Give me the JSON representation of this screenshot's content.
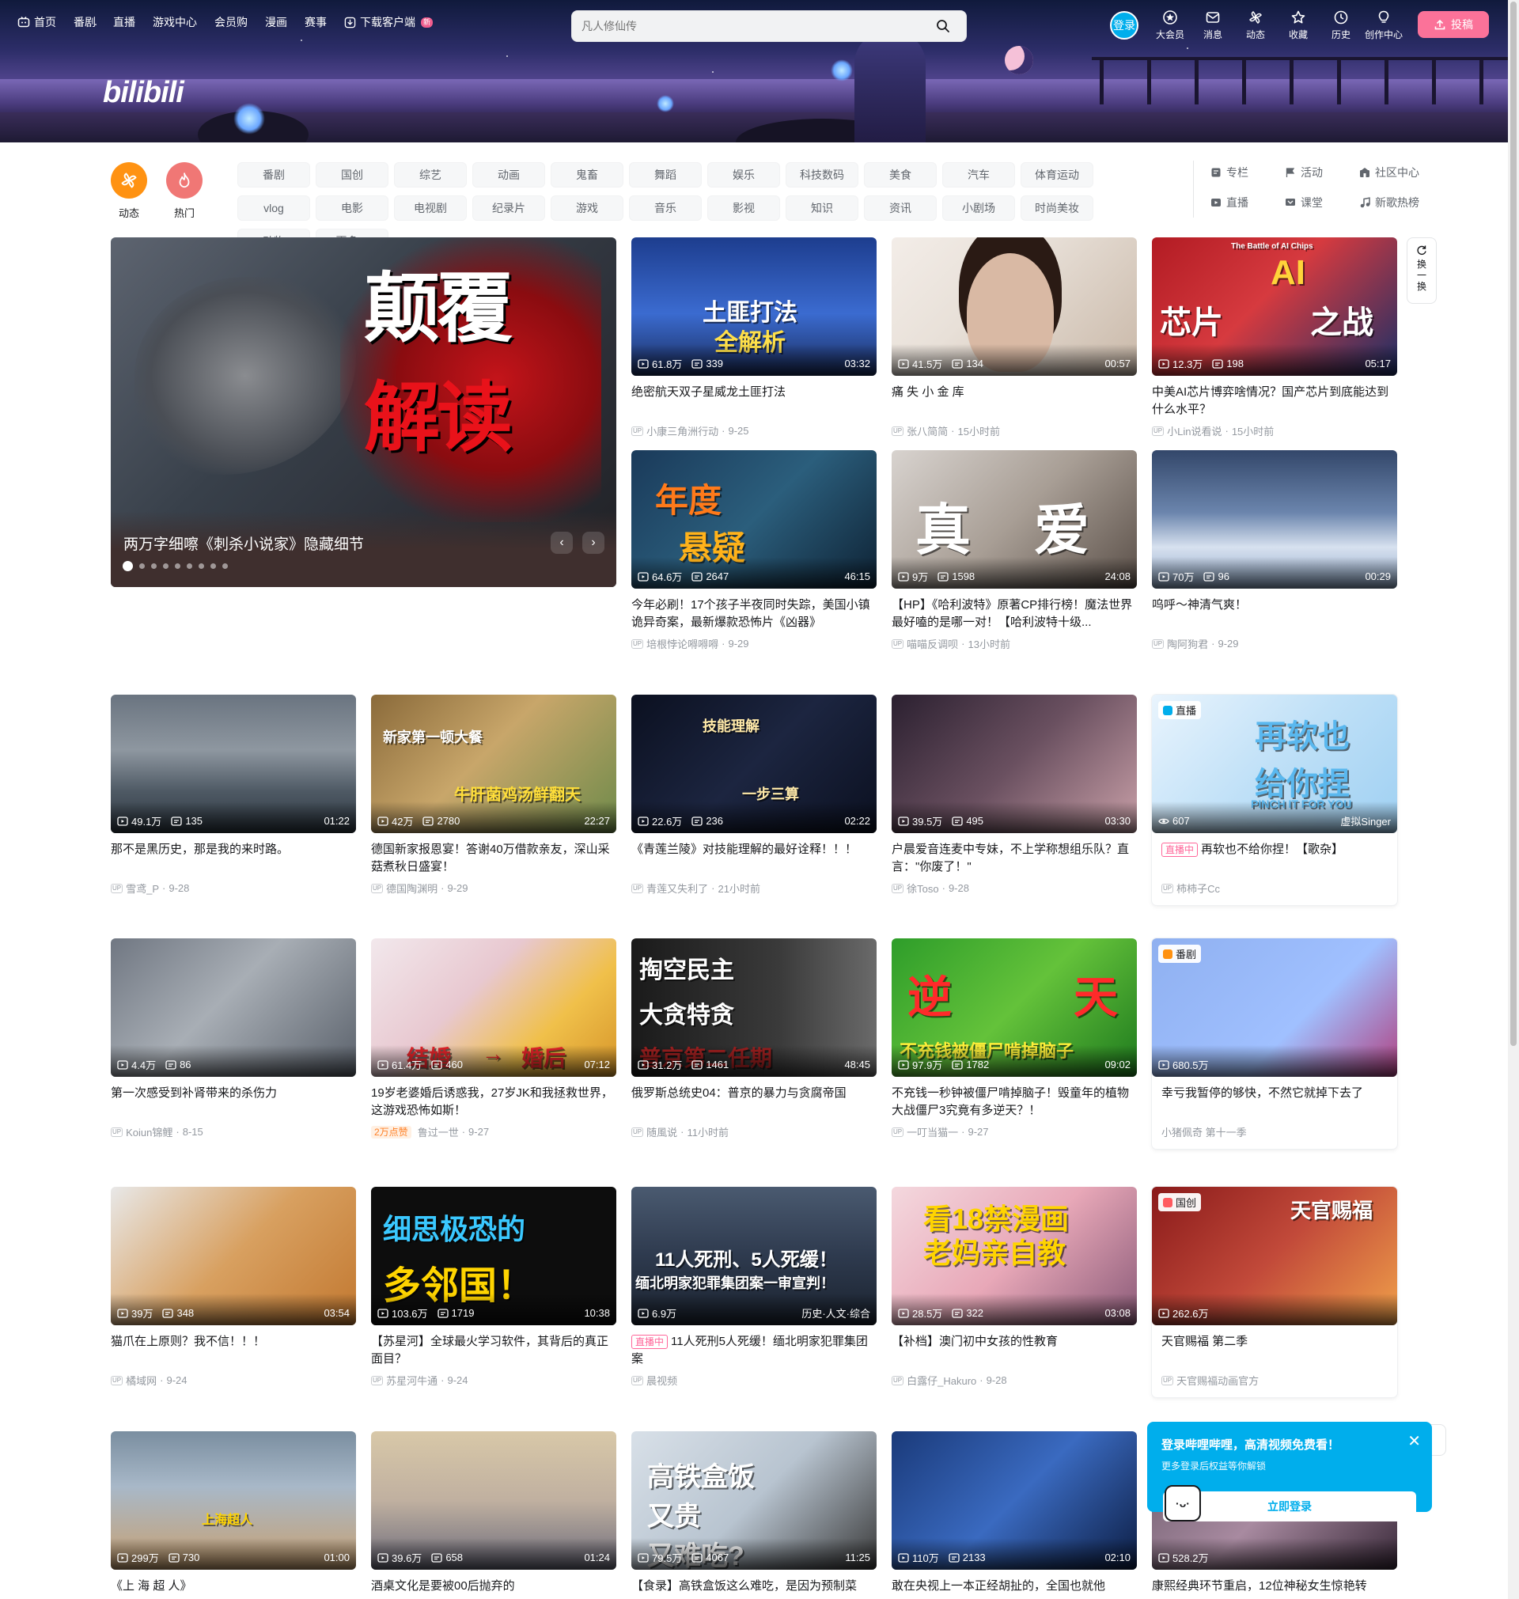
{
  "header": {
    "nav": [
      {
        "label": "首页",
        "icon": "tv-icon"
      },
      {
        "label": "番剧"
      },
      {
        "label": "直播"
      },
      {
        "label": "游戏中心"
      },
      {
        "label": "会员购"
      },
      {
        "label": "漫画"
      },
      {
        "label": "赛事"
      },
      {
        "label": "下载客户端",
        "icon": "download-icon",
        "badge": "新"
      }
    ],
    "logo": "bilibili",
    "search_placeholder": "凡人修仙传",
    "login_avatar": "登录",
    "right_nav": [
      "大会员",
      "消息",
      "动态",
      "收藏",
      "历史",
      "创作中心"
    ],
    "upload_label": "投稿"
  },
  "channels": {
    "featured": [
      {
        "label": "动态",
        "color": "#ff9212"
      },
      {
        "label": "热门",
        "color": "#f07775"
      }
    ],
    "grid": [
      "番剧",
      "国创",
      "综艺",
      "动画",
      "鬼畜",
      "舞蹈",
      "娱乐",
      "科技数码",
      "美食",
      "汽车",
      "体育运动",
      "vlog",
      "电影",
      "电视剧",
      "纪录片",
      "游戏",
      "音乐",
      "影视",
      "知识",
      "资讯",
      "小剧场",
      "时尚美妆",
      "动物",
      "更多"
    ],
    "right": [
      {
        "label": "专栏",
        "icon": "article-icon"
      },
      {
        "label": "活动",
        "icon": "flag-icon"
      },
      {
        "label": "社区中心",
        "icon": "community-icon"
      },
      {
        "label": "直播",
        "icon": "live-icon"
      },
      {
        "label": "课堂",
        "icon": "classroom-icon"
      },
      {
        "label": "新歌热榜",
        "icon": "music-chart-icon"
      }
    ]
  },
  "carousel": {
    "title": "两万字细嚓《刺杀小说家》隐藏细节",
    "overlay_line1": "颠覆",
    "overlay_line2": "解读",
    "dots": 9
  },
  "refresh_label": [
    "换",
    "一",
    "换"
  ],
  "videos": [
    {
      "title": "绝密航天双子星威龙土匪打法",
      "views": "61.8万",
      "danmaku": "339",
      "duration": "03:32",
      "author": "小康三角洲行动",
      "date": "9-25",
      "overlay": "土匪打法 全解析"
    },
    {
      "title": "痛 失 小 金 库",
      "views": "41.5万",
      "danmaku": "134",
      "duration": "00:57",
      "author": "张八简简",
      "date": "15小时前"
    },
    {
      "title": "中美AI芯片博弈啥情况？国产芯片到底能达到什么水平？",
      "views": "12.3万",
      "danmaku": "198",
      "duration": "05:17",
      "author": "小Lin说看说",
      "date": "15小时前",
      "overlay": "AI 芯片 之战",
      "overlay_small": "The Battle of AI Chips"
    },
    {
      "title": "今年必刷！17个孩子半夜同时失踪，美国小镇诡异奇案，最新爆款恐怖片《凶器》",
      "views": "64.6万",
      "danmaku": "2647",
      "duration": "46:15",
      "author": "培根悖论嘚嘚嘚",
      "date": "9-29",
      "overlay": "年度 悬疑"
    },
    {
      "title": "【HP】《哈利波特》原著CP排行榜！魔法世界最好嗑的是哪一对！【哈利波特十级...",
      "views": "9万",
      "danmaku": "1598",
      "duration": "24:08",
      "author": "喵喵反调呗",
      "date": "13小时前",
      "overlay": "真 爱"
    },
    {
      "title": "呜呼～神清气爽！",
      "views": "70万",
      "danmaku": "96",
      "duration": "00:29",
      "author": "陶阿狗君",
      "date": "9-29"
    },
    {
      "title": "那不是黑历史，那是我的来时路。",
      "views": "49.1万",
      "danmaku": "135",
      "duration": "01:22",
      "author": "雪鸢_P",
      "date": "9-28"
    },
    {
      "title": "德国新家报恩宴！答谢40万借款亲友，深山采菇煮秋日盛宴！",
      "views": "42万",
      "danmaku": "2780",
      "duration": "22:27",
      "author": "德国陶渊明",
      "date": "9-29",
      "overlay": "新家第一顿大餐 牛肝菌鸡汤鲜翻天"
    },
    {
      "title": "《青莲兰陵》对技能理解的最好诠释！！！",
      "views": "22.6万",
      "danmaku": "236",
      "duration": "02:22",
      "author": "青莲又失利了",
      "date": "21小时前",
      "overlay": "技能理解 一步三算"
    },
    {
      "title": "户晨爱音连麦中专妹，不上学称想组乐队？直言：\"你废了！\"",
      "views": "39.5万",
      "danmaku": "495",
      "duration": "03:30",
      "author": "徐Toso",
      "date": "9-28"
    },
    {
      "title": "再软也不给你捏！【歌杂】",
      "viewers": "607",
      "badge": "直播",
      "live_tag": "直播中",
      "corner": "虚拟Singer",
      "author": "柿柿子Cc",
      "overlay": "再软也 给你捏",
      "overlay_small": "PINCH IT FOR YOU"
    },
    {
      "title": "第一次感受到补肾带来的杀伤力",
      "views": "4.4万",
      "danmaku": "86",
      "duration": "",
      "author": "Koiun锦鲤",
      "date": "8-15"
    },
    {
      "title": "19岁老婆婚后诱惑我，27岁JK和我拯救世界，这游戏恐怖如斯！",
      "views": "61.4万",
      "danmaku": "460",
      "duration": "07:12",
      "author": "鲁过一世",
      "date": "9-27",
      "hot_tag": "2万点赞",
      "overlay": "结婚 → 婚后"
    },
    {
      "title": "俄罗斯总统史04：普京的暴力与贪腐帝国",
      "views": "31.2万",
      "danmaku": "1461",
      "duration": "48:45",
      "author": "随風说",
      "date": "11小时前",
      "overlay": "掏空民主 大贪特贪 普京第二任期"
    },
    {
      "title": "不充钱一秒钟被僵尸啃掉脑子！毁童年的植物大战僵尸3究竟有多逆天？！",
      "views": "97.9万",
      "danmaku": "1782",
      "duration": "09:02",
      "author": "一叮当猫一",
      "date": "9-27",
      "overlay": "逆 天 不充钱被僵尸啃掉脑子"
    },
    {
      "title": "幸亏我暂停的够快，不然它就掉下去了",
      "views": "680.5万",
      "badge": "番剧",
      "author": "小猪佩奇 第十一季"
    },
    {
      "title": "猫爪在上原则？我不信！！！",
      "views": "39万",
      "danmaku": "348",
      "duration": "03:54",
      "author": "橘域网",
      "date": "9-24"
    },
    {
      "title": "【苏星河】全球最火学习软件，其背后的真正面目？",
      "views": "103.6万",
      "danmaku": "1719",
      "duration": "10:38",
      "author": "苏星河牛通",
      "date": "9-24",
      "overlay": "细思极恐的 多邻国！"
    },
    {
      "title": "11人死刑5人死缓！缅北明家犯罪集团案",
      "views": "6.9万",
      "duration": "历史·人文·综合",
      "author": "晨视频",
      "live_tag": "直播中",
      "overlay": "11人死刑、5人死缓！ 缅北明家犯罪集团案一审宣判！"
    },
    {
      "title": "【补档】澳门初中女孩的性教育",
      "views": "28.5万",
      "danmaku": "322",
      "duration": "03:08",
      "author": "白露仔_Hakuro",
      "date": "9-28",
      "overlay": "看18禁漫画 老妈亲自教"
    },
    {
      "title": "天官赐福 第二季",
      "views": "262.6万",
      "badge": "国创",
      "author": "天官赐福动画官方",
      "overlay": "天官赐福"
    },
    {
      "title": "《上 海 超 人》",
      "views": "299万",
      "danmaku": "730",
      "duration": "01:00",
      "overlay": "上海超人"
    },
    {
      "title": "酒桌文化是要被00后抛弃的",
      "views": "39.6万",
      "danmaku": "658",
      "duration": "01:24"
    },
    {
      "title": "【食录】高铁盒饭这么难吃，是因为预制菜",
      "views": "79.5万",
      "danmaku": "4067",
      "duration": "11:25",
      "overlay": "高铁盒饭 又贵 又难吃?"
    },
    {
      "title": "敢在央视上一本正经胡扯的，全国也就他",
      "views": "110万",
      "danmaku": "2133",
      "duration": "02:10"
    },
    {
      "title": "康熙经典环节重启，12位神秘女生惊艳转",
      "views": "528.2万"
    }
  ],
  "login_popup": {
    "title": "登录哔哩哔哩，高清视频免费看！",
    "subtitle": "更多登录后权益等你解锁",
    "button": "立即登录"
  }
}
